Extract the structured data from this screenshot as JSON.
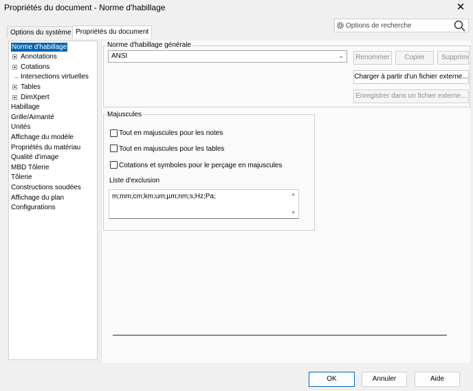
{
  "window": {
    "title": "Propriétés du document - Norme d'habillage",
    "close_glyph": "✕"
  },
  "tabs": [
    {
      "label": "Options du système"
    },
    {
      "label": "Propriétés du document"
    }
  ],
  "search": {
    "placeholder": "Options de recherche",
    "icon": "search-icon",
    "gear_icon": "gear-icon"
  },
  "tree": {
    "items": [
      {
        "label": "Norme d'habillage",
        "selected": true
      },
      {
        "label": "Annotations",
        "expandable": true
      },
      {
        "label": "Cotations",
        "expandable": true
      },
      {
        "label": "Intersections virtuelles"
      },
      {
        "label": "Tables",
        "expandable": true
      },
      {
        "label": "DimXpert",
        "expandable": true
      },
      {
        "label": "Habillage"
      },
      {
        "label": "Grille/Aimanté"
      },
      {
        "label": "Unités"
      },
      {
        "label": "Affichage du modèle"
      },
      {
        "label": "Propriétés du matériau"
      },
      {
        "label": "Qualité d'image"
      },
      {
        "label": "MBD Tôlerie"
      },
      {
        "label": "Tôlerie"
      },
      {
        "label": "Constructions soudées"
      },
      {
        "label": "Affichage du plan"
      },
      {
        "label": "Configurations"
      }
    ]
  },
  "standard": {
    "group_title": "Norme d'habillage générale",
    "selected": "ANSI",
    "buttons": {
      "rename": "Renommer",
      "copy": "Copier",
      "delete": "Supprimer",
      "load": "Charger à partir d'un fichier externe...",
      "save": "Enregistrer dans un fichier externe..."
    }
  },
  "uppercase": {
    "group_title": "Majuscules",
    "options": [
      {
        "label": "Tout en majuscules pour les notes",
        "checked": false
      },
      {
        "label": "Tout en majuscules pour les tables",
        "checked": false
      },
      {
        "label": "Cotations et symboles pour le perçage en majuscules",
        "checked": false
      }
    ],
    "exclusion_label": "Liste d'exclusion",
    "exclusion_value": "m;mm;cm;km;um;µm;nm;s;Hz;Pa;"
  },
  "footer": {
    "ok": "OK",
    "cancel": "Annuler",
    "help": "Aide"
  },
  "colors": {
    "selection": "#0a64ad",
    "primary_border": "#0067c0"
  }
}
